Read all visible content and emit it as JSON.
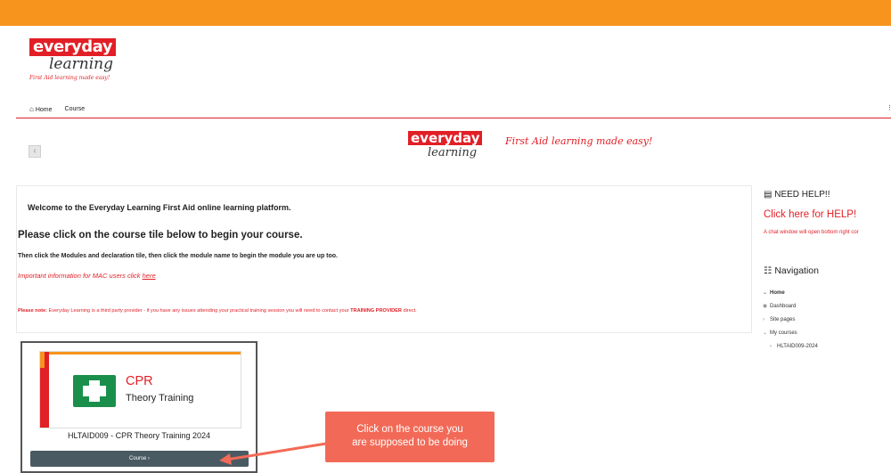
{
  "brand": {
    "logo_word": "everyday",
    "logo_sub": "learning",
    "tagline": "First Aid learning made easy!"
  },
  "nav": {
    "home": "Home",
    "course": "Course",
    "more": "⋮"
  },
  "main": {
    "welcome": "Welcome to the Everyday Learning First Aid online learning platform.",
    "please": "Please click on the course tile below to begin your course.",
    "then": "Then click the Modules and declaration tile, then click the module name to begin the module you are up too.",
    "mac_text": "Important information for MAC users click ",
    "mac_link": "here",
    "note_label": "Please note:",
    "note_text": " Everyday Learning is a third party provider - if you have any issues attending your practical training session you will need to contact your ",
    "note_strong": "TRAINING PROVIDER",
    "note_end": " direct."
  },
  "sidebar": {
    "help_title": "NEED HELP!!",
    "help_link": "Click here for HELP!",
    "help_sub": "A chat window will open bottom right cor",
    "nav_title": "Navigation",
    "items": [
      {
        "label": "Home"
      },
      {
        "label": "Dashboard"
      },
      {
        "label": "Site pages"
      },
      {
        "label": "My courses"
      },
      {
        "label": "HLTAID009-2024"
      }
    ]
  },
  "course_card": {
    "title_big": "CPR",
    "title_small": "Theory Training",
    "name": "HLTAID009 - CPR Theory Training 2024",
    "button": "Course ›"
  },
  "callout": {
    "text_line1": "Click on the course you",
    "text_line2": "are supposed to be doing"
  },
  "colors": {
    "topbar": "#f7941d",
    "brand_red": "#e21f26",
    "button": "#4a5a63",
    "callout": "#f26a57",
    "cross_green": "#1a8f4b"
  },
  "icons": [
    "home-icon",
    "back-arrow-icon",
    "help-card-icon",
    "sitemap-icon",
    "first-aid-cross-icon",
    "chevron-icon",
    "more-vertical-icon"
  ]
}
